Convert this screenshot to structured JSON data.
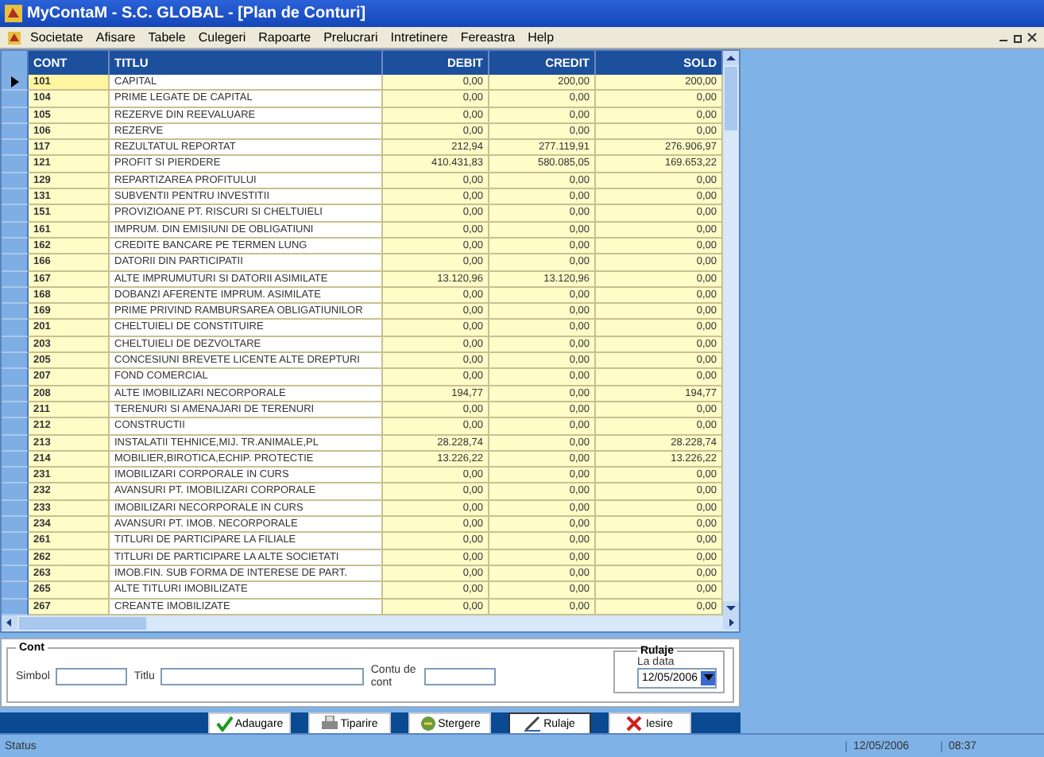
{
  "window": {
    "title": "MyContaM - S.C. GLOBAL - [Plan de Conturi]"
  },
  "menu": [
    "Societate",
    "Afisare",
    "Tabele",
    "Culegeri",
    "Rapoarte",
    "Prelucrari",
    "Intretinere",
    "Fereastra",
    "Help"
  ],
  "table": {
    "columns": [
      "CONT",
      "TITLU",
      "DEBIT",
      "CREDIT",
      "SOLD"
    ],
    "rows": [
      {
        "selected": true,
        "cells": [
          "101",
          "CAPITAL",
          "0,00",
          "200,00",
          "200,00"
        ]
      },
      {
        "selected": false,
        "cells": [
          "104",
          "PRIME LEGATE DE CAPITAL",
          "0,00",
          "0,00",
          "0,00"
        ]
      },
      {
        "selected": false,
        "cells": [
          "105",
          "REZERVE DIN REEVALUARE",
          "0,00",
          "0,00",
          "0,00"
        ]
      },
      {
        "selected": false,
        "cells": [
          "106",
          "REZERVE",
          "0,00",
          "0,00",
          "0,00"
        ]
      },
      {
        "selected": false,
        "cells": [
          "117",
          "REZULTATUL REPORTAT",
          "212,94",
          "277.119,91",
          "276.906,97"
        ]
      },
      {
        "selected": false,
        "cells": [
          "121",
          "PROFIT SI PIERDERE",
          "410.431,83",
          "580.085,05",
          "169.653,22"
        ]
      },
      {
        "selected": false,
        "cells": [
          "129",
          "REPARTIZAREA PROFITULUI",
          "0,00",
          "0,00",
          "0,00"
        ]
      },
      {
        "selected": false,
        "cells": [
          "131",
          "SUBVENTII PENTRU INVESTITII",
          "0,00",
          "0,00",
          "0,00"
        ]
      },
      {
        "selected": false,
        "cells": [
          "151",
          "PROVIZIOANE PT. RISCURI SI CHELTUIELI",
          "0,00",
          "0,00",
          "0,00"
        ]
      },
      {
        "selected": false,
        "cells": [
          "161",
          "IMPRUM. DIN EMISIUNI DE OBLIGATIUNI",
          "0,00",
          "0,00",
          "0,00"
        ]
      },
      {
        "selected": false,
        "cells": [
          "162",
          "CREDITE BANCARE PE TERMEN LUNG",
          "0,00",
          "0,00",
          "0,00"
        ]
      },
      {
        "selected": false,
        "cells": [
          "166",
          "DATORII DIN PARTICIPATII",
          "0,00",
          "0,00",
          "0,00"
        ]
      },
      {
        "selected": false,
        "cells": [
          "167",
          "ALTE IMPRUMUTURI SI DATORII ASIMILATE",
          "13.120,96",
          "13.120,96",
          "0,00"
        ]
      },
      {
        "selected": false,
        "cells": [
          "168",
          "DOBANZI AFERENTE IMPRUM. ASIMILATE",
          "0,00",
          "0,00",
          "0,00"
        ]
      },
      {
        "selected": false,
        "cells": [
          "169",
          "PRIME PRIVIND RAMBURSAREA OBLIGATIUNILOR",
          "0,00",
          "0,00",
          "0,00"
        ]
      },
      {
        "selected": false,
        "cells": [
          "201",
          "CHELTUIELI DE CONSTITUIRE",
          "0,00",
          "0,00",
          "0,00"
        ]
      },
      {
        "selected": false,
        "cells": [
          "203",
          "CHELTUIELI DE DEZVOLTARE",
          "0,00",
          "0,00",
          "0,00"
        ]
      },
      {
        "selected": false,
        "cells": [
          "205",
          "CONCESIUNI BREVETE LICENTE ALTE DREPTURI",
          "0,00",
          "0,00",
          "0,00"
        ]
      },
      {
        "selected": false,
        "cells": [
          "207",
          "FOND COMERCIAL",
          "0,00",
          "0,00",
          "0,00"
        ]
      },
      {
        "selected": false,
        "cells": [
          "208",
          "ALTE IMOBILIZARI NECORPORALE",
          "194,77",
          "0,00",
          "194,77"
        ]
      },
      {
        "selected": false,
        "cells": [
          "211",
          "TERENURI SI AMENAJARI DE TERENURI",
          "0,00",
          "0,00",
          "0,00"
        ]
      },
      {
        "selected": false,
        "cells": [
          "212",
          "CONSTRUCTII",
          "0,00",
          "0,00",
          "0,00"
        ]
      },
      {
        "selected": false,
        "cells": [
          "213",
          "INSTALATII TEHNICE,MIJ. TR.ANIMALE,PL",
          "28.228,74",
          "0,00",
          "28.228,74"
        ]
      },
      {
        "selected": false,
        "cells": [
          "214",
          "MOBILIER,BIROTICA,ECHIP. PROTECTIE",
          "13.226,22",
          "0,00",
          "13.226,22"
        ]
      },
      {
        "selected": false,
        "cells": [
          "231",
          "IMOBILIZARI CORPORALE IN CURS",
          "0,00",
          "0,00",
          "0,00"
        ]
      },
      {
        "selected": false,
        "cells": [
          "232",
          "AVANSURI PT. IMOBILIZARI CORPORALE",
          "0,00",
          "0,00",
          "0,00"
        ]
      },
      {
        "selected": false,
        "cells": [
          "233",
          "IMOBILIZARI NECORPORALE IN CURS",
          "0,00",
          "0,00",
          "0,00"
        ]
      },
      {
        "selected": false,
        "cells": [
          "234",
          "AVANSURI PT. IMOB. NECORPORALE",
          "0,00",
          "0,00",
          "0,00"
        ]
      },
      {
        "selected": false,
        "cells": [
          "261",
          "TITLURI DE PARTICIPARE LA FILIALE",
          "0,00",
          "0,00",
          "0,00"
        ]
      },
      {
        "selected": false,
        "cells": [
          "262",
          "TITLURI DE PARTICIPARE LA ALTE SOCIETATI",
          "0,00",
          "0,00",
          "0,00"
        ]
      },
      {
        "selected": false,
        "cells": [
          "263",
          "IMOB.FIN. SUB FORMA DE INTERESE DE PART.",
          "0,00",
          "0,00",
          "0,00"
        ]
      },
      {
        "selected": false,
        "cells": [
          "265",
          "ALTE TITLURI IMOBILIZATE",
          "0,00",
          "0,00",
          "0,00"
        ]
      },
      {
        "selected": false,
        "cells": [
          "267",
          "CREANTE IMOBILIZATE",
          "0,00",
          "0,00",
          "0,00"
        ]
      }
    ]
  },
  "cont_group": {
    "title": "Cont",
    "simbol_label": "Simbol",
    "titlu_label": "Titlu",
    "contul_label": "Contu de cont"
  },
  "rulaje_group": {
    "title": "Rulaje",
    "date_label": "La data",
    "date_value": "12/05/2006"
  },
  "buttons": [
    {
      "kind": "add",
      "label": "Adaugare"
    },
    {
      "kind": "print",
      "label": "Tiparire"
    },
    {
      "kind": "delete",
      "label": "Stergere"
    },
    {
      "kind": "rulaje",
      "label": "Rulaje"
    },
    {
      "kind": "exit",
      "label": "Iesire"
    }
  ],
  "status_bar": {
    "text": "Status",
    "date": "12/05/2006",
    "time": "08:37"
  }
}
